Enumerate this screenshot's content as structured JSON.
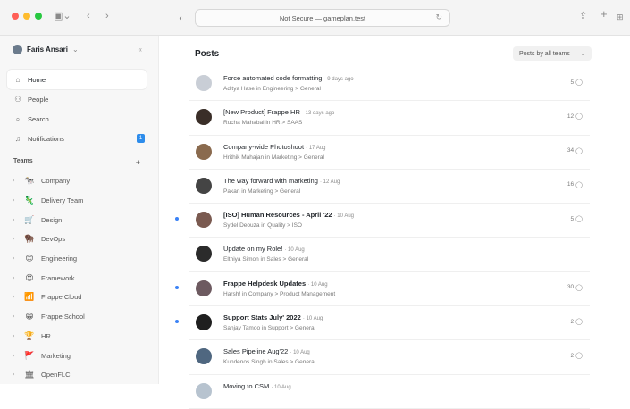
{
  "browser": {
    "url": "Not Secure — gameplan.test",
    "shield_icon": "shield-icon",
    "share_icon": "share-icon",
    "new_tab_icon": "plus-icon",
    "tabs_icon": "grid-icon"
  },
  "sidebar": {
    "user_name": "Faris Ansari",
    "nav": [
      {
        "label": "Home",
        "icon": "home-icon"
      },
      {
        "label": "People",
        "icon": "people-icon"
      },
      {
        "label": "Search",
        "icon": "search-icon"
      },
      {
        "label": "Notifications",
        "icon": "bell-icon",
        "badge": "1"
      }
    ],
    "teams_label": "Teams",
    "teams": [
      {
        "label": "Company",
        "emoji": "🐄"
      },
      {
        "label": "Delivery Team",
        "emoji": "🦎"
      },
      {
        "label": "Design",
        "emoji": "🛒"
      },
      {
        "label": "DevOps",
        "emoji": "🦬"
      },
      {
        "label": "Engineering",
        "emoji": "😊"
      },
      {
        "label": "Framework",
        "emoji": "😍"
      },
      {
        "label": "Frappe Cloud",
        "emoji": "📶"
      },
      {
        "label": "Frappe School",
        "emoji": "😁"
      },
      {
        "label": "HR",
        "emoji": "🏆"
      },
      {
        "label": "Marketing",
        "emoji": "🚩"
      },
      {
        "label": "OpenFLC",
        "emoji": "🏛"
      }
    ]
  },
  "main": {
    "title": "Posts",
    "filter_label": "Posts by all teams",
    "posts": [
      {
        "title": "Force automated code formatting",
        "date": "· 9 days ago",
        "sub": "Aditya Hase in Engineering > General",
        "count": "5",
        "unread": false,
        "bold": false,
        "avatar": "#c9ced6"
      },
      {
        "title": "[New Product] Frappe HR",
        "date": "· 13 days ago",
        "sub": "Rucha Mahabal in HR > SAAS",
        "count": "12",
        "unread": false,
        "bold": false,
        "avatar": "#3a2e28"
      },
      {
        "title": "Company-wide Photoshoot",
        "date": "· 17 Aug",
        "sub": "Hrithik Mahajan in Marketing > General",
        "count": "34",
        "unread": false,
        "bold": false,
        "avatar": "#8a6a4e"
      },
      {
        "title": "The way forward with marketing",
        "date": "· 12 Aug",
        "sub": "Pakan in Marketing > General",
        "count": "16",
        "unread": false,
        "bold": false,
        "avatar": "#444444"
      },
      {
        "title": "[ISO] Human Resources - April '22",
        "date": "· 10 Aug",
        "sub": "Sydel Deouza in Quality > ISO",
        "count": "5",
        "unread": true,
        "bold": true,
        "avatar": "#7a5a50"
      },
      {
        "title": "Update on my Role!",
        "date": "· 10 Aug",
        "sub": "Elthiya Simon in Sales > General",
        "count": "",
        "unread": false,
        "bold": false,
        "avatar": "#2b2b2b"
      },
      {
        "title": "Frappe Helpdesk Updates",
        "date": "· 10 Aug",
        "sub": "Harsh! in Company > Product Management",
        "count": "30",
        "unread": true,
        "bold": true,
        "avatar": "#6d5a60"
      },
      {
        "title": "Support Stats July' 2022",
        "date": "· 10 Aug",
        "sub": "Sanjay Tamoo in Support > General",
        "count": "2",
        "unread": true,
        "bold": true,
        "avatar": "#1f1f1f"
      },
      {
        "title": "Sales Pipeline Aug'22",
        "date": "· 10 Aug",
        "sub": "Kundenos Singh in Sales > General",
        "count": "2",
        "unread": false,
        "bold": false,
        "avatar": "#4f6780"
      },
      {
        "title": "Moving to CSM",
        "date": "· 10 Aug",
        "sub": "",
        "count": "",
        "unread": false,
        "bold": false,
        "avatar": "#b7c3cf"
      }
    ]
  }
}
